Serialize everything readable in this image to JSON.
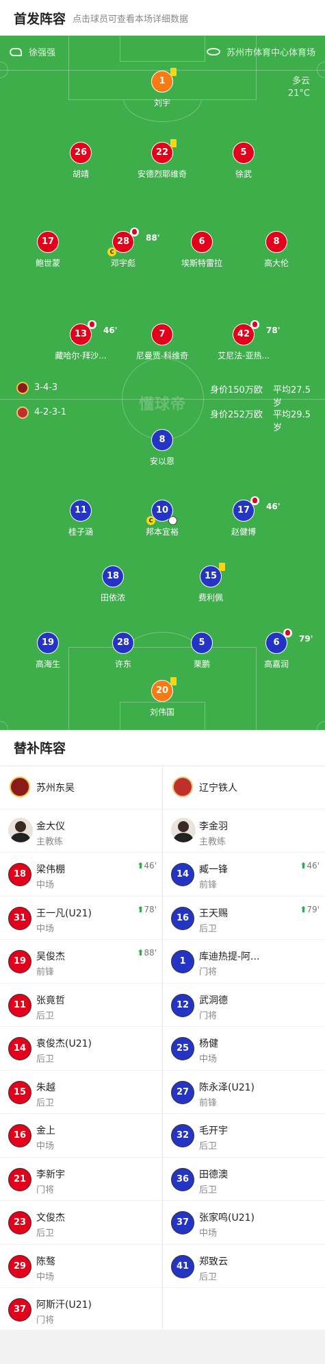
{
  "header": {
    "title": "首发阵容",
    "hint": "点击球员可查看本场详细数据"
  },
  "match": {
    "referee": "徐强强",
    "venue": "苏州市体育中心体育场",
    "weather": "多云",
    "temperature": "21°C",
    "watermark": "懂球帝"
  },
  "home": {
    "formation": "3-4-3",
    "value": "身价150万欧",
    "age": "平均27.5岁",
    "color": "#e3001b"
  },
  "away": {
    "formation": "4-2-3-1",
    "value": "身价252万欧",
    "age": "平均29.5岁",
    "color": "#2434c3"
  },
  "starters": [
    {
      "num": "1",
      "name": "刘宇",
      "team": "orange",
      "yellow": true
    },
    {
      "num": "26",
      "name": "胡靖",
      "team": "red"
    },
    {
      "num": "22",
      "name": "安德烈耶维奇",
      "team": "red",
      "yellow": true
    },
    {
      "num": "5",
      "name": "徐武",
      "team": "red"
    },
    {
      "num": "17",
      "name": "鲍世蒙",
      "team": "red"
    },
    {
      "num": "28",
      "name": "邓宇彪",
      "team": "red",
      "sub": "88'",
      "captain": "C"
    },
    {
      "num": "6",
      "name": "埃斯特雷拉",
      "team": "red"
    },
    {
      "num": "8",
      "name": "高大伦",
      "team": "red"
    },
    {
      "num": "13",
      "name": "藏哈尔·拜沙...",
      "team": "red",
      "sub": "46'"
    },
    {
      "num": "7",
      "name": "尼曼贾-科维奇",
      "team": "red"
    },
    {
      "num": "42",
      "name": "艾尼法-亚热...",
      "team": "red",
      "sub": "78'"
    },
    {
      "num": "8",
      "name": "安以恩",
      "team": "blue"
    },
    {
      "num": "11",
      "name": "桂子涵",
      "team": "blue"
    },
    {
      "num": "10",
      "name": "邦本宜裕",
      "team": "blue",
      "captain": "C",
      "goal": true
    },
    {
      "num": "17",
      "name": "赵健博",
      "team": "blue",
      "sub": "46'"
    },
    {
      "num": "18",
      "name": "田依浓",
      "team": "blue"
    },
    {
      "num": "15",
      "name": "费利佩",
      "team": "blue",
      "yellow": true
    },
    {
      "num": "19",
      "name": "高海生",
      "team": "blue"
    },
    {
      "num": "28",
      "name": "许东",
      "team": "blue"
    },
    {
      "num": "5",
      "name": "栗鹏",
      "team": "blue"
    },
    {
      "num": "6",
      "name": "高嘉润",
      "team": "blue",
      "sub": "79'"
    },
    {
      "num": "20",
      "name": "刘伟国",
      "team": "orange",
      "yellow": true
    }
  ],
  "subs": {
    "title": "替补阵容",
    "left": {
      "team": "苏州东吴",
      "coach": {
        "name": "金大仪",
        "role": "主教练"
      },
      "players": [
        {
          "num": "18",
          "name": "梁伟棚",
          "pos": "中场",
          "event": "46'"
        },
        {
          "num": "31",
          "name": "王一凡(U21)",
          "pos": "中场",
          "event": "78'"
        },
        {
          "num": "19",
          "name": "吴俊杰",
          "pos": "前锋",
          "event": "88'"
        },
        {
          "num": "11",
          "name": "张竟哲",
          "pos": "后卫",
          "event": ""
        },
        {
          "num": "14",
          "name": "袁俊杰(U21)",
          "pos": "后卫",
          "event": ""
        },
        {
          "num": "15",
          "name": "朱越",
          "pos": "后卫",
          "event": ""
        },
        {
          "num": "16",
          "name": "金上",
          "pos": "中场",
          "event": ""
        },
        {
          "num": "21",
          "name": "李新宇",
          "pos": "门将",
          "event": ""
        },
        {
          "num": "23",
          "name": "文俊杰",
          "pos": "后卫",
          "event": ""
        },
        {
          "num": "29",
          "name": "陈骜",
          "pos": "中场",
          "event": ""
        },
        {
          "num": "37",
          "name": "阿斯汗(U21)",
          "pos": "门将",
          "event": ""
        }
      ]
    },
    "right": {
      "team": "辽宁铁人",
      "coach": {
        "name": "李金羽",
        "role": "主教练"
      },
      "players": [
        {
          "num": "14",
          "name": "臧一锋",
          "pos": "前锋",
          "event": "46'"
        },
        {
          "num": "16",
          "name": "王天赐",
          "pos": "后卫",
          "event": "79'"
        },
        {
          "num": "1",
          "name": "库迪热提-阿...",
          "pos": "门将",
          "event": ""
        },
        {
          "num": "12",
          "name": "武洞德",
          "pos": "门将",
          "event": ""
        },
        {
          "num": "25",
          "name": "杨健",
          "pos": "中场",
          "event": ""
        },
        {
          "num": "27",
          "name": "陈永泽(U21)",
          "pos": "前锋",
          "event": ""
        },
        {
          "num": "32",
          "name": "毛开宇",
          "pos": "后卫",
          "event": ""
        },
        {
          "num": "36",
          "name": "田德澳",
          "pos": "后卫",
          "event": ""
        },
        {
          "num": "37",
          "name": "张家鸣(U21)",
          "pos": "中场",
          "event": ""
        },
        {
          "num": "41",
          "name": "郑致云",
          "pos": "后卫",
          "event": ""
        }
      ]
    }
  }
}
